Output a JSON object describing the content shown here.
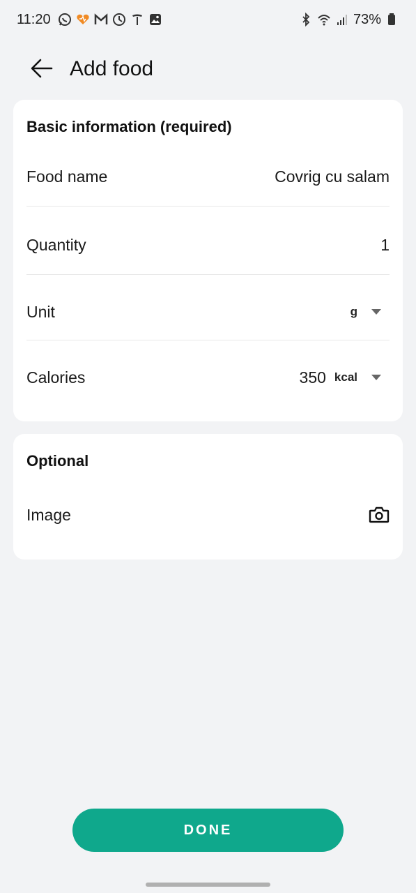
{
  "status_bar": {
    "time": "11:20",
    "battery": "73%",
    "left_icons": [
      "whatsapp-icon",
      "heart-app-icon",
      "gmail-icon",
      "clock-icon",
      "tesla-icon",
      "gallery-icon"
    ],
    "right_icons": [
      "bluetooth-icon",
      "wifi-icon",
      "signal-icon",
      "battery-icon"
    ]
  },
  "header": {
    "title": "Add food",
    "back_icon": "arrow-left-icon"
  },
  "basic": {
    "title": "Basic information (required)",
    "food_name_label": "Food name",
    "food_name_value": "Covrig cu salam",
    "quantity_label": "Quantity",
    "quantity_value": "1",
    "unit_label": "Unit",
    "unit_value": "g",
    "calories_label": "Calories",
    "calories_value": "350",
    "calories_unit": "kcal"
  },
  "optional": {
    "title": "Optional",
    "image_label": "Image",
    "image_icon": "camera-icon"
  },
  "actions": {
    "done_label": "DONE"
  },
  "colors": {
    "accent": "#0fa88c",
    "background": "#f2f3f5",
    "card": "#ffffff"
  }
}
